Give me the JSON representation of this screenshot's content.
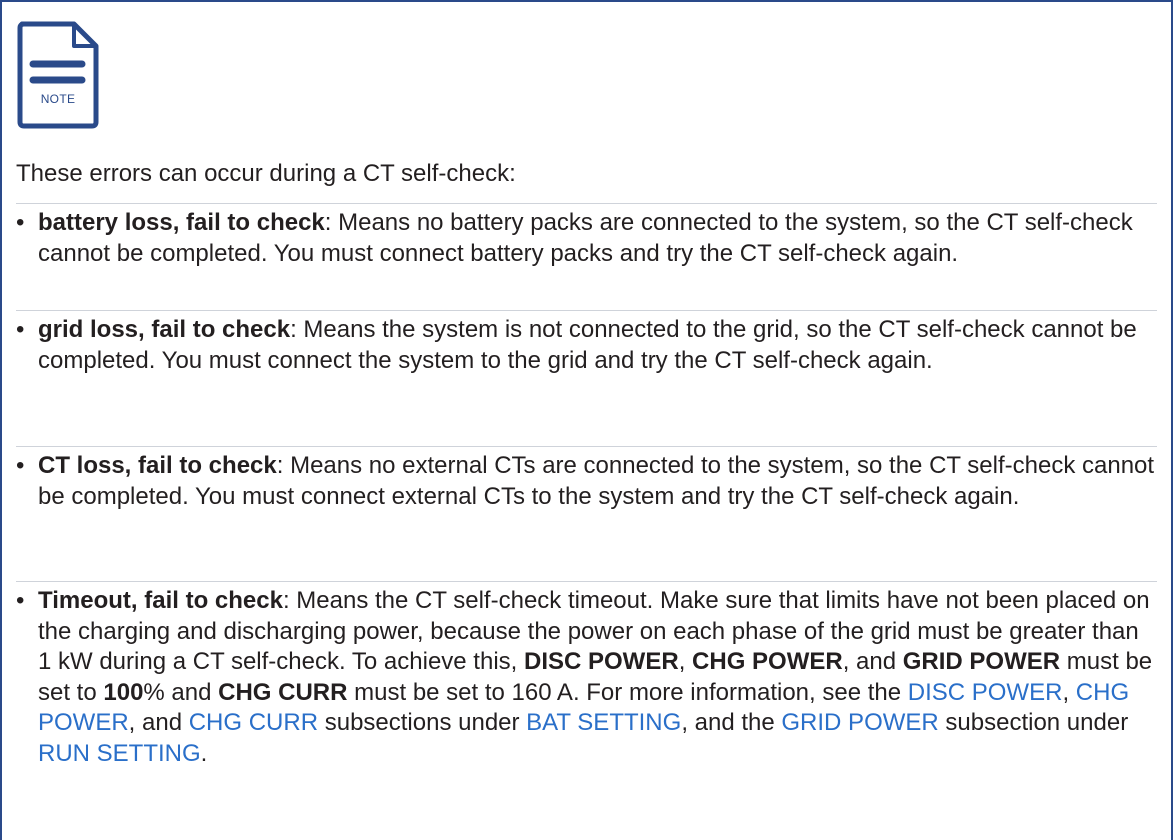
{
  "note": {
    "icon_label": "NOTE",
    "icon_name": "note-document-icon",
    "accent_color": "#2a4a8a",
    "link_color": "#2a6fc9"
  },
  "intro": "These errors can occur during a CT self-check:",
  "items": [
    {
      "term": "battery loss, fail to check",
      "text": ": Means no battery packs are connected to the system, so the CT self-check cannot be completed. You must connect battery packs and try the CT self-check again."
    },
    {
      "term": "grid loss, fail to check",
      "text": ": Means the system is not connected to the grid, so the CT self-check cannot be completed. You must connect the system to the grid and try the CT self-check again."
    },
    {
      "term": "CT loss, fail to check",
      "text": ": Means no external CTs are connected to the system, so the CT self-check cannot be completed. You must connect external CTs to the system and try the CT self-check again."
    },
    {
      "term": "Timeout, fail to check",
      "text_1": ": Means the CT self-check timeout. Make sure that limits have not been placed on the charging and discharging power, because the power on each phase of the grid must be greater than 1 kW during a CT self-check. To achieve this, ",
      "bold_disc_power": "DISC POWER",
      "sep_1": ", ",
      "bold_chg_power": "CHG POWER",
      "sep_2": ", and ",
      "bold_grid_power": "GRID POWER",
      "text_2": " must be set to ",
      "bold_100": "100",
      "text_3": "% and ",
      "bold_chg_curr": "CHG CURR",
      "text_4": " must be set to 160 A. For more information, see the ",
      "link_disc_power": "DISC POWER",
      "sep_3": ", ",
      "link_chg_power": "CHG POWER",
      "sep_4": ", and ",
      "link_chg_curr": "CHG CURR",
      "text_5": " subsections under ",
      "link_bat_setting": "BAT SETTING",
      "text_6": ", and the ",
      "link_grid_power": "GRID POWER",
      "text_7": " subsection under ",
      "link_run_setting": "RUN SETTING",
      "text_8": "."
    }
  ],
  "bullet_char": "•"
}
